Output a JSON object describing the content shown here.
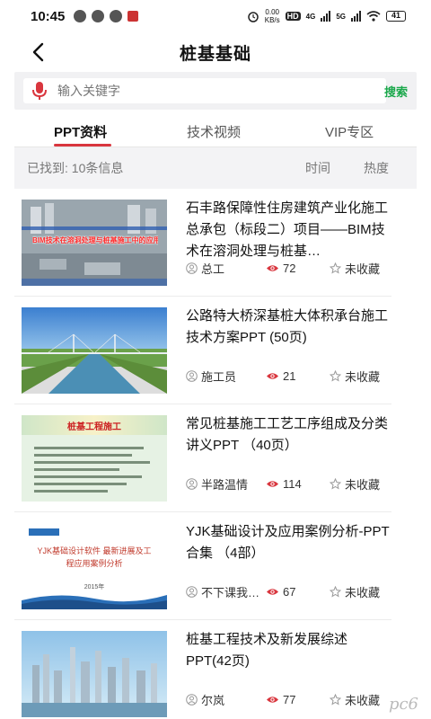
{
  "status_bar": {
    "time": "10:45",
    "net_speed_value": "0.00",
    "net_speed_unit": "KB/s",
    "hd": "HD",
    "sig1_label": "4G",
    "sig2_label": "5G",
    "battery": "41"
  },
  "nav": {
    "title": "桩基基础"
  },
  "search": {
    "placeholder": "输入关键字",
    "button_label": "搜索"
  },
  "tabs": [
    {
      "label": "PPT资料",
      "active": true
    },
    {
      "label": "技术视频",
      "active": false
    },
    {
      "label": "VIP专区",
      "active": false
    }
  ],
  "filter": {
    "found_text": "已找到: 10条信息",
    "sort_time": "时间",
    "sort_heat": "热度"
  },
  "items": [
    {
      "title": "石丰路保障性住房建筑产业化施工总承包（标段二）项目——BIM技术在溶洞处理与桩基…",
      "author": "总工",
      "views": "72",
      "fav": "未收藏",
      "thumb_text": "BIM技术在溶洞处理与桩基施工中的应用"
    },
    {
      "title": "公路特大桥深基桩大体积承台施工技术方案PPT (50页)",
      "author": "施工员",
      "views": "21",
      "fav": "未收藏",
      "thumb_text": ""
    },
    {
      "title": "常见桩基施工工艺工序组成及分类讲义PPT （40页）",
      "author": "半路温情",
      "views": "114",
      "fav": "未收藏",
      "thumb_text": "桩基工程施工"
    },
    {
      "title": "YJK基础设计及应用案例分析-PPT合集 （4部）",
      "author": "不下课我…",
      "views": "67",
      "fav": "未收藏",
      "thumb_text": "YJK基础设计软件 最新进展及工程应用案例分析",
      "thumb_year": "2015年"
    },
    {
      "title": "桩基工程技术及新发展综述PPT(42页)",
      "author": "尔岚",
      "views": "77",
      "fav": "未收藏",
      "thumb_text": ""
    }
  ],
  "colors": {
    "accent_red": "#d9363e",
    "search_green": "#1aa84b",
    "eye_red": "#d9363e"
  },
  "watermark": "pc6"
}
